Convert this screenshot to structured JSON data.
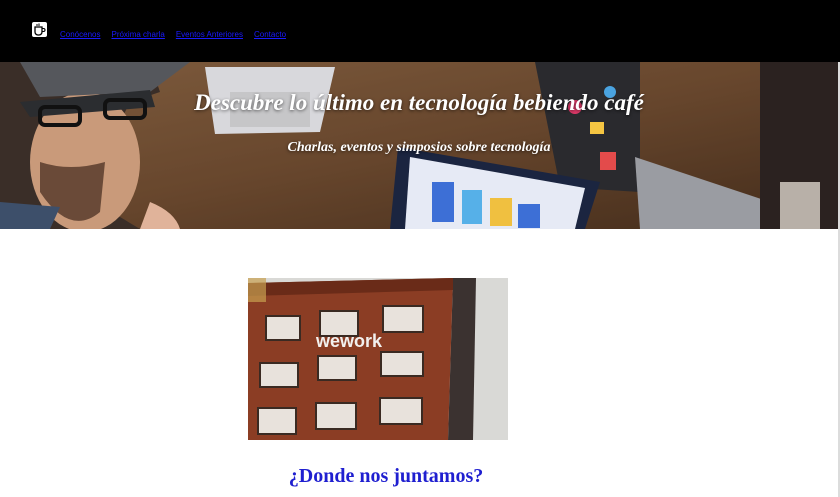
{
  "navbar": {
    "logo_icon": "coffee-cup-icon",
    "links": [
      {
        "label": "Conócenos"
      },
      {
        "label": "Próxima charla"
      },
      {
        "label": "Eventos Anteriores"
      },
      {
        "label": "Contacto"
      }
    ]
  },
  "hero": {
    "title": "Descubre lo último en tecnología bebiendo café",
    "subtitle": "Charlas, eventos y simposios sobre tecnología"
  },
  "photo": {
    "sign_text": "wework"
  },
  "location_section": {
    "title": "¿Donde nos juntamos?"
  },
  "colors": {
    "navbar_bg": "#000000",
    "link": "#1a1aff",
    "section_title": "#1f1fd0"
  }
}
